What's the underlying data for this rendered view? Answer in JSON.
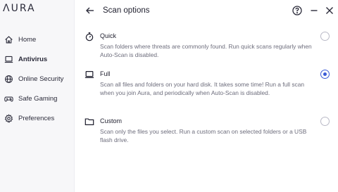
{
  "app": {
    "logo": "ΛURA"
  },
  "sidebar": {
    "items": [
      {
        "label": "Home",
        "icon": "home-icon",
        "active": false
      },
      {
        "label": "Antivirus",
        "icon": "laptop-icon",
        "active": true
      },
      {
        "label": "Online Security",
        "icon": "globe-icon",
        "active": false
      },
      {
        "label": "Safe Gaming",
        "icon": "gamepad-icon",
        "active": false
      },
      {
        "label": "Preferences",
        "icon": "gear-icon",
        "active": false
      }
    ]
  },
  "header": {
    "title": "Scan options",
    "icons": [
      "back-arrow-icon",
      "help-icon",
      "minimize-icon",
      "close-icon"
    ]
  },
  "options": [
    {
      "title": "Quick",
      "icon": "stopwatch-icon",
      "description": "Scan folders where threats are commonly found. Run quick scans regularly when Auto-Scan is disabled.",
      "selected": false
    },
    {
      "title": "Full",
      "icon": "laptop-icon",
      "description": "Scan all files and folders on your hard disk. It takes some time! Run a full scan when you join Aura, and periodically when Auto-Scan is disabled.",
      "selected": true
    },
    {
      "title": "Custom",
      "icon": "folder-icon",
      "description": "Scan only the files you select. Run a custom scan on selected folders or a USB flash drive.",
      "selected": false
    }
  ],
  "colors": {
    "accent": "#3b5bd6",
    "sidebar_bg": "#f7f7f9",
    "text": "#1f1f2e",
    "muted": "#6d6d7c"
  }
}
